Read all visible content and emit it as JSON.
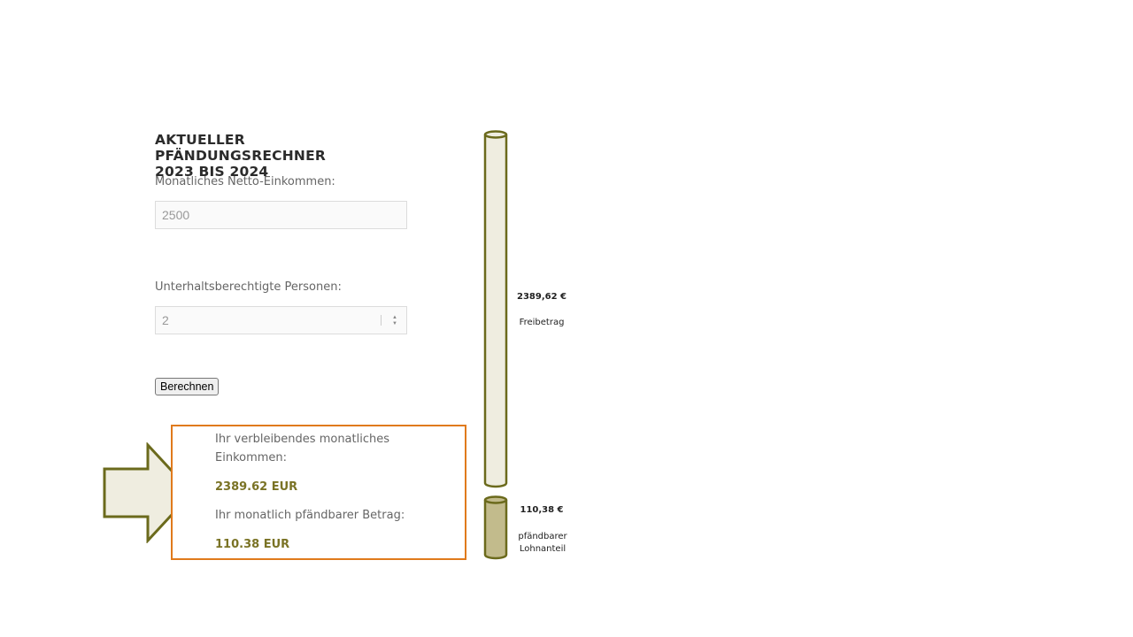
{
  "calculator": {
    "title": "AKTUELLER PFÄNDUNGSRECHNER\n2023 BIS 2024",
    "income_label": "Monatliches Netto-Einkommen:",
    "income_value": "2500",
    "persons_label": "Unterhaltsberechtigte Personen:",
    "persons_value": "2",
    "calculate_button": "Berechnen"
  },
  "results": {
    "remaining_label": "Ihr verbleibendes monatliches Einkommen:",
    "remaining_value": "2389.62 EUR",
    "seizable_label": "Ihr monatlich pfändbarer Betrag:",
    "seizable_value": "110.38 EUR"
  },
  "bars": {
    "free": {
      "amount": "2389,62 €",
      "label": "Freibetrag"
    },
    "seizable": {
      "amount": "110,38 €",
      "label": "pfändbarer\nLohnanteil"
    }
  },
  "colors": {
    "accent_olive": "#6b6a1c",
    "value_olive": "#7a7325",
    "result_border": "#e07a1c",
    "bar_light": "#efede0",
    "bar_dark": "#c2bb8c"
  }
}
